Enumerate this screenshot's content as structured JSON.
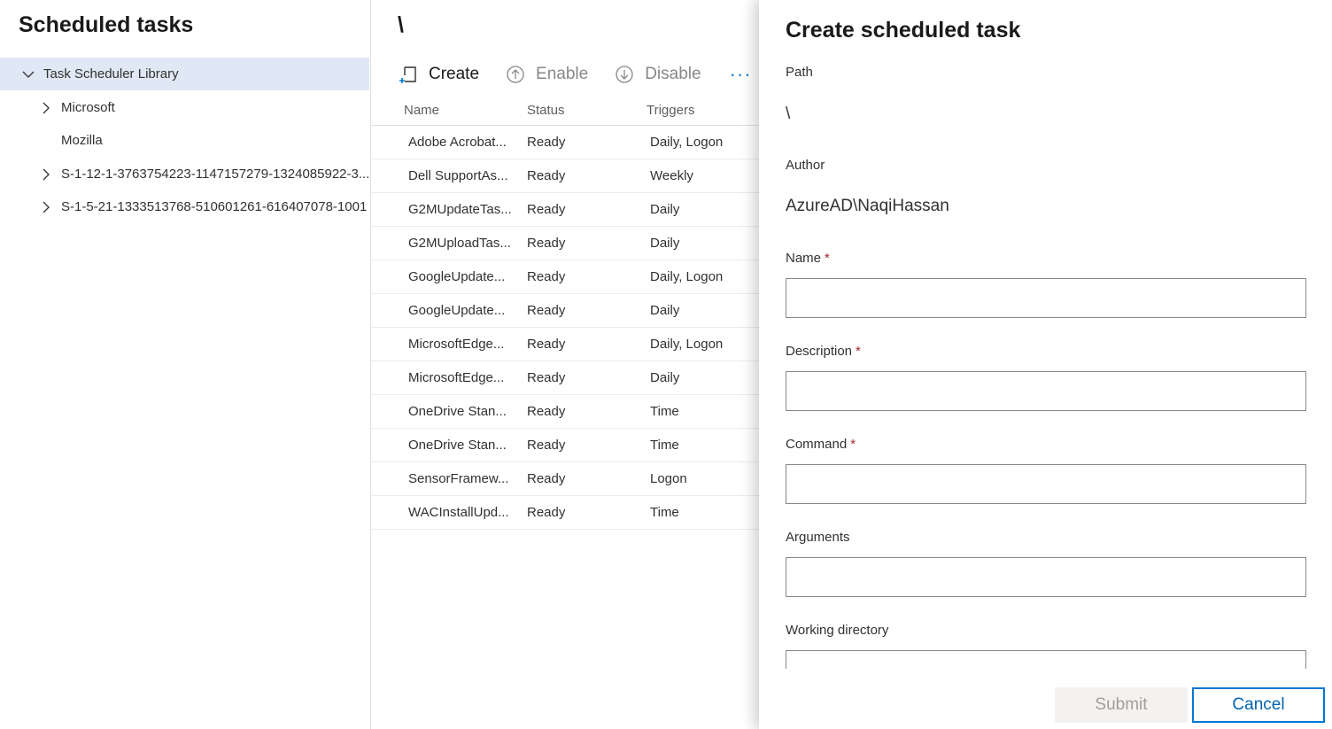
{
  "left": {
    "title": "Scheduled tasks",
    "tree": [
      {
        "label": "Task Scheduler Library",
        "expanded": true,
        "selected": true
      },
      {
        "label": "Microsoft",
        "expandable": true
      },
      {
        "label": "Mozilla",
        "expandable": false
      },
      {
        "label": "S-1-12-1-3763754223-1147157279-1324085922-3...",
        "expandable": true
      },
      {
        "label": "S-1-5-21-1333513768-510601261-616407078-1001",
        "expandable": true
      }
    ]
  },
  "middle": {
    "title": "\\",
    "toolbar": {
      "create": "Create",
      "enable": "Enable",
      "disable": "Disable",
      "more": "···"
    },
    "columns": {
      "name": "Name",
      "status": "Status",
      "triggers": "Triggers"
    },
    "rows": [
      {
        "name": "Adobe Acrobat...",
        "status": "Ready",
        "triggers": "Daily, Logon"
      },
      {
        "name": "Dell SupportAs...",
        "status": "Ready",
        "triggers": "Weekly"
      },
      {
        "name": "G2MUpdateTas...",
        "status": "Ready",
        "triggers": "Daily"
      },
      {
        "name": "G2MUploadTas...",
        "status": "Ready",
        "triggers": "Daily"
      },
      {
        "name": "GoogleUpdate...",
        "status": "Ready",
        "triggers": "Daily, Logon"
      },
      {
        "name": "GoogleUpdate...",
        "status": "Ready",
        "triggers": "Daily"
      },
      {
        "name": "MicrosoftEdge...",
        "status": "Ready",
        "triggers": "Daily, Logon"
      },
      {
        "name": "MicrosoftEdge...",
        "status": "Ready",
        "triggers": "Daily"
      },
      {
        "name": "OneDrive Stan...",
        "status": "Ready",
        "triggers": "Time"
      },
      {
        "name": "OneDrive Stan...",
        "status": "Ready",
        "triggers": "Time"
      },
      {
        "name": "SensorFramew...",
        "status": "Ready",
        "triggers": "Logon"
      },
      {
        "name": "WACInstallUpd...",
        "status": "Ready",
        "triggers": "Time"
      }
    ]
  },
  "panel": {
    "title": "Create scheduled task",
    "path_label": "Path",
    "path_value": "\\",
    "author_label": "Author",
    "author_value": "AzureAD\\NaqiHassan",
    "name_label": "Name",
    "description_label": "Description",
    "command_label": "Command",
    "arguments_label": "Arguments",
    "working_dir_label": "Working directory",
    "required_mark": "*",
    "submit": "Submit",
    "cancel": "Cancel"
  },
  "colors": {
    "accent": "#0078d4",
    "required": "#a4262c",
    "selected_bg": "#dfe8f4"
  }
}
